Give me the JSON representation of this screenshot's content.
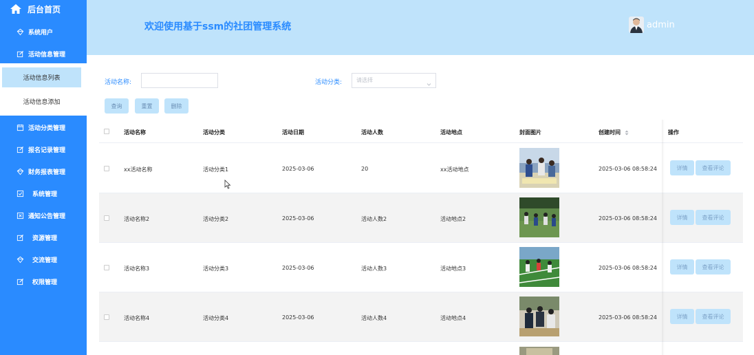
{
  "sidebar": {
    "home_label": "后台首页",
    "items": [
      {
        "label": "系统用户",
        "icon": "diamond-icon"
      },
      {
        "label": "活动信息管理",
        "icon": "edit-icon"
      },
      {
        "label": "活动分类管理",
        "icon": "calendar-icon"
      },
      {
        "label": "报名记录管理",
        "icon": "edit-icon"
      },
      {
        "label": "财务报表管理",
        "icon": "diamond-icon"
      },
      {
        "label": "系统管理",
        "icon": "checkbox-icon"
      },
      {
        "label": "通知公告管理",
        "icon": "close-box-icon"
      },
      {
        "label": "资源管理",
        "icon": "edit-icon"
      },
      {
        "label": "交流管理",
        "icon": "diamond-icon"
      },
      {
        "label": "权限管理",
        "icon": "edit-icon"
      }
    ],
    "submenu": [
      {
        "label": "活动信息列表",
        "active": true
      },
      {
        "label": "活动信息添加",
        "active": false
      }
    ]
  },
  "header": {
    "title": "欢迎使用基于ssm的社团管理系统",
    "username": "admin"
  },
  "search": {
    "name_label": "活动名称:",
    "name_value": "",
    "category_label": "活动分类:",
    "category_placeholder": "请选择",
    "query_button": "查询",
    "reset_button": "重置",
    "delete_button": "删除"
  },
  "table": {
    "columns": [
      "活动名称",
      "活动分类",
      "活动日期",
      "活动人数",
      "活动地点",
      "封面图片",
      "创建时间",
      "操作"
    ],
    "rows": [
      {
        "name": "xx活动名称",
        "category": "活动分类1",
        "date": "2025-03-06",
        "count": "20",
        "location": "xx活动地点",
        "created": "2025-03-06 08:58:24"
      },
      {
        "name": "活动名称2",
        "category": "活动分类2",
        "date": "2025-03-06",
        "count": "活动人数2",
        "location": "活动地点2",
        "created": "2025-03-06 08:58:24"
      },
      {
        "name": "活动名称3",
        "category": "活动分类3",
        "date": "2025-03-06",
        "count": "活动人数3",
        "location": "活动地点3",
        "created": "2025-03-06 08:58:24"
      },
      {
        "name": "活动名称4",
        "category": "活动分类4",
        "date": "2025-03-06",
        "count": "活动人数4",
        "location": "活动地点4",
        "created": "2025-03-06 08:58:24"
      }
    ],
    "detail_button": "详情",
    "comment_button": "查看评论"
  },
  "colors": {
    "primary": "#2a8bff",
    "light": "#bfe3fb"
  }
}
